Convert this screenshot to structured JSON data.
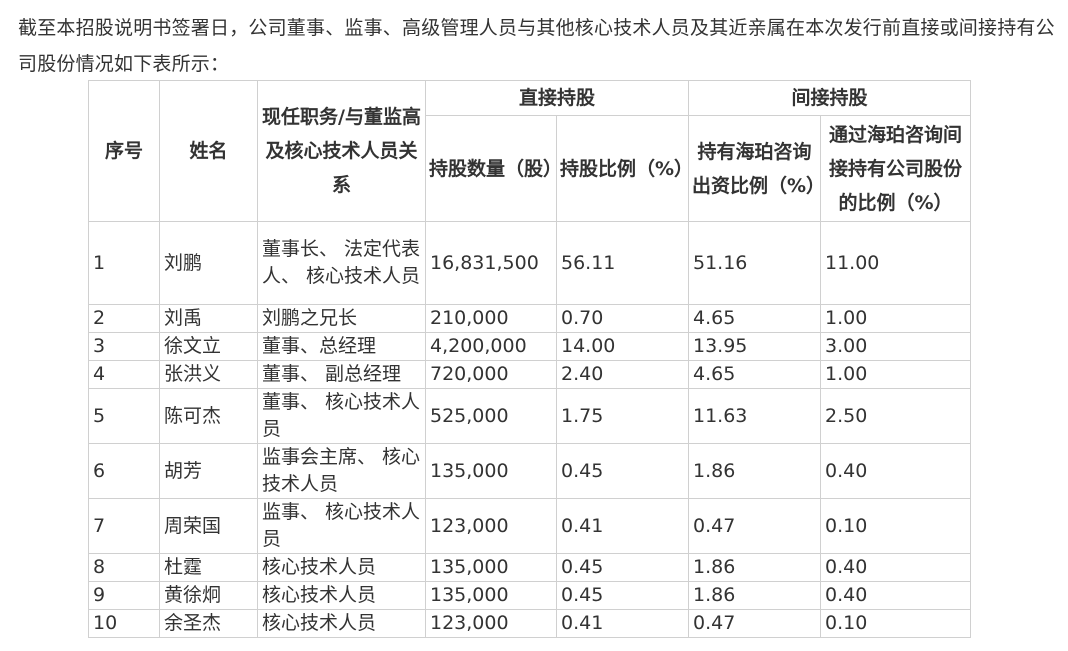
{
  "intro": "截至本招股说明书签署日，公司董事、监事、高级管理人员与其他核心技术人员及其近亲属在本次发行前直接或间接持有公司股份情况如下表所示：",
  "table": {
    "headers": {
      "seq": "序号",
      "name": "姓名",
      "position": "现任职务/与董监高及核心技术人员关系",
      "direct_group": "直接持股",
      "indirect_group": "间接持股",
      "direct_shares": "持股数量（股）",
      "direct_ratio": "持股比例（%）",
      "haipo_ratio": "持有海珀咨询出资比例（%）",
      "indirect_ratio": "通过海珀咨询间接持有公司股份的比例（%）"
    },
    "rows": [
      {
        "seq": "1",
        "name": "刘鹏",
        "position": "董事长、 法定代表人、 核心技术人员",
        "shares": "16,831,500",
        "ratio": "56.11",
        "haipo": "51.16",
        "indirect": "11.00"
      },
      {
        "seq": "2",
        "name": "刘禹",
        "position": "刘鹏之兄长",
        "shares": "210,000",
        "ratio": "0.70",
        "haipo": "4.65",
        "indirect": "1.00"
      },
      {
        "seq": "3",
        "name": "徐文立",
        "position": "董事、总经理",
        "shares": "4,200,000",
        "ratio": "14.00",
        "haipo": "13.95",
        "indirect": "3.00"
      },
      {
        "seq": "4",
        "name": "张洪义",
        "position": "董事、 副总经理",
        "shares": "720,000",
        "ratio": "2.40",
        "haipo": "4.65",
        "indirect": "1.00"
      },
      {
        "seq": "5",
        "name": "陈可杰",
        "position": "董事、 核心技术人员",
        "shares": "525,000",
        "ratio": "1.75",
        "haipo": "11.63",
        "indirect": "2.50"
      },
      {
        "seq": "6",
        "name": "胡芳",
        "position": "监事会主席、 核心技术人员",
        "shares": "135,000",
        "ratio": "0.45",
        "haipo": "1.86",
        "indirect": "0.40"
      },
      {
        "seq": "7",
        "name": "周荣国",
        "position": "监事、 核心技术人员",
        "shares": "123,000",
        "ratio": "0.41",
        "haipo": "0.47",
        "indirect": "0.10"
      },
      {
        "seq": "8",
        "name": "杜霆",
        "position": "核心技术人员",
        "shares": "135,000",
        "ratio": "0.45",
        "haipo": "1.86",
        "indirect": "0.40"
      },
      {
        "seq": "9",
        "name": "黄徐炯",
        "position": "核心技术人员",
        "shares": "135,000",
        "ratio": "0.45",
        "haipo": "1.86",
        "indirect": "0.40"
      },
      {
        "seq": "10",
        "name": "余圣杰",
        "position": "核心技术人员",
        "shares": "123,000",
        "ratio": "0.41",
        "haipo": "0.47",
        "indirect": "0.10"
      }
    ]
  }
}
